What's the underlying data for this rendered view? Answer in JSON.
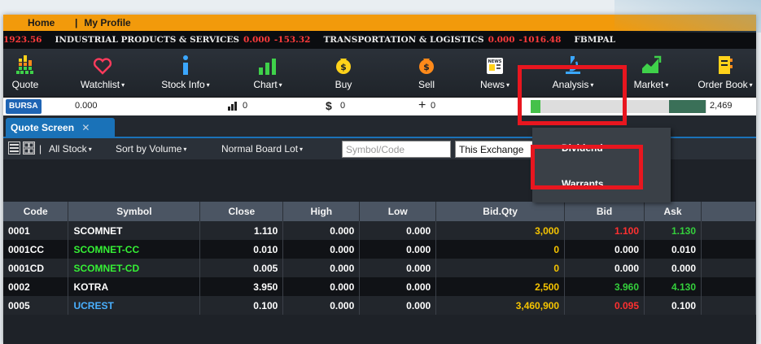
{
  "topnav": {
    "home": "Home",
    "separator": "|",
    "profile": "My Profile"
  },
  "ticker": {
    "lead_value": "1923.56",
    "items": [
      {
        "name": "INDUSTRIAL PRODUCTS & SERVICES",
        "change": "0.000",
        "value": "-153.32"
      },
      {
        "name": "TRANSPORTATION & LOGISTICS",
        "change": "0.000",
        "value": "-1016.48"
      }
    ],
    "tail": "FBMPAL"
  },
  "toolbar": {
    "quote": "Quote",
    "watchlist": "Watchlist",
    "stock_info": "Stock Info",
    "chart": "Chart",
    "buy": "Buy",
    "sell": "Sell",
    "news": "News",
    "analysis": "Analysis",
    "market": "Market",
    "order_book": "Order Book",
    "caret": "▾",
    "news_badge": "NEWS"
  },
  "stats": {
    "exchange": "BURSA",
    "value": "0.000",
    "volume": "0",
    "amount_symbol": "$",
    "amount": "0",
    "change_symbol": "+",
    "change": "0",
    "up_count_marker": "0",
    "total": "2,469"
  },
  "tabs": {
    "active": "Quote Screen",
    "close": "✕"
  },
  "filters": {
    "separator": "|",
    "stock": "All Stock",
    "sort": "Sort by Volume",
    "board": "Normal Board Lot",
    "symbol_placeholder": "Symbol/Code",
    "exchange": "This Exchange"
  },
  "analysis_menu": {
    "items": [
      "Dividend",
      "Warrants"
    ]
  },
  "table": {
    "headers": [
      "Code",
      "Symbol",
      "Close",
      "High",
      "Low",
      "Bid.Qty",
      "Bid",
      "Ask"
    ],
    "rows": [
      {
        "code": "0001",
        "symbol": "SCOMNET",
        "close": "1.110",
        "high": "0.000",
        "low": "0.000",
        "bidqty": "3,000",
        "bid": "1.100",
        "ask": "1.130"
      },
      {
        "code": "0001CC",
        "symbol": "SCOMNET-CC",
        "close": "0.010",
        "high": "0.000",
        "low": "0.000",
        "bidqty": "0",
        "bid": "0.000",
        "ask": "0.010"
      },
      {
        "code": "0001CD",
        "symbol": "SCOMNET-CD",
        "close": "0.005",
        "high": "0.000",
        "low": "0.000",
        "bidqty": "0",
        "bid": "0.000",
        "ask": "0.000"
      },
      {
        "code": "0002",
        "symbol": "KOTRA",
        "close": "3.950",
        "high": "0.000",
        "low": "0.000",
        "bidqty": "2,500",
        "bid": "3.960",
        "ask": "4.130"
      },
      {
        "code": "0005",
        "symbol": "UCREST",
        "close": "0.100",
        "high": "0.000",
        "low": "0.000",
        "bidqty": "3,460,900",
        "bid": "0.095",
        "ask": "0.100"
      }
    ]
  },
  "colors": {
    "accent": "#f29a0b",
    "tab": "#1a72b8",
    "highlight": "#e8161f",
    "up": "#34d03c",
    "down": "#ff3030"
  }
}
